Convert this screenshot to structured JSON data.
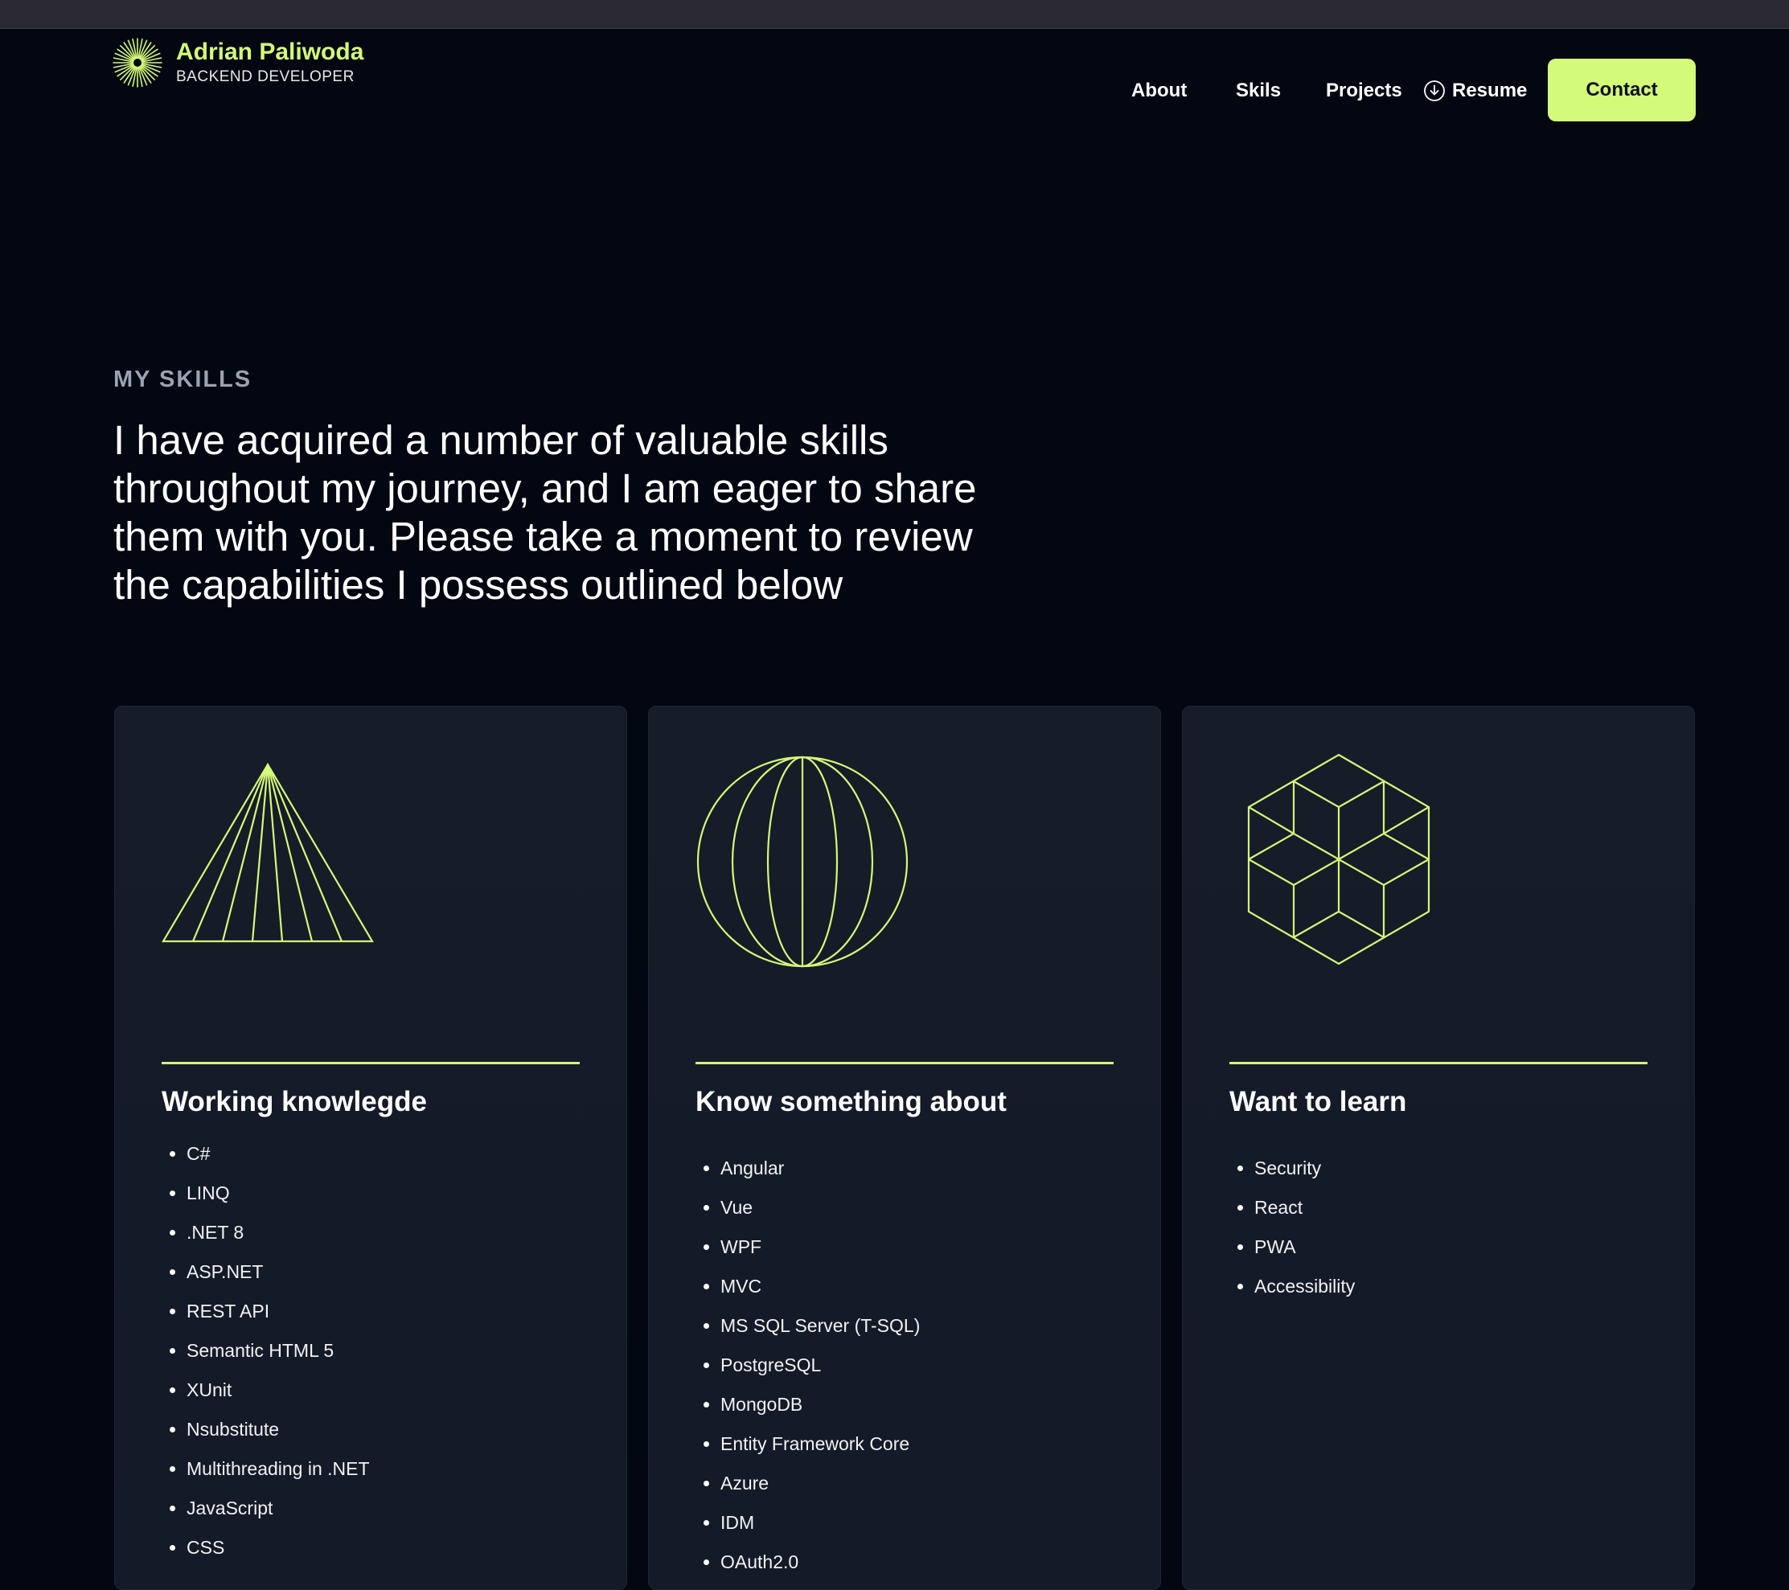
{
  "header": {
    "name": "Adrian Paliwoda",
    "role": "BACKEND DEVELOPER",
    "nav": {
      "about": "About",
      "skills": "Skils",
      "projects": "Projects",
      "resume": "Resume",
      "contact": "Contact"
    }
  },
  "hero": {
    "eyebrow": "MY SKILLS",
    "headline": "I have acquired a number of valuable skills throughout my journey, and I am eager to share them with you. Please take a moment to review the capabilities I possess outlined below"
  },
  "cards": [
    {
      "title": "Working knowlegde",
      "icon": "triangle-rays-icon",
      "items": [
        "C#",
        "LINQ",
        ".NET 8",
        "ASP.NET",
        "REST API",
        "Semantic HTML 5",
        "XUnit",
        "Nsubstitute",
        "Multithreading in .NET",
        "JavaScript",
        "CSS"
      ]
    },
    {
      "title": "Know something about",
      "icon": "globe-icon",
      "items": [
        "Angular",
        "Vue",
        "WPF",
        "MVC",
        "MS SQL Server (T-SQL)",
        "PostgreSQL",
        "MongoDB",
        "Entity Framework Core",
        "Azure",
        "IDM",
        "OAuth2.0"
      ]
    },
    {
      "title": "Want to learn",
      "icon": "cube-hexagon-icon",
      "items": [
        "Security",
        "React",
        "PWA",
        "Accessibility"
      ]
    }
  ],
  "colors": {
    "accent": "#d4fa7a",
    "background": "#020711",
    "card": "#161c28",
    "muted": "#9aa3b2"
  }
}
